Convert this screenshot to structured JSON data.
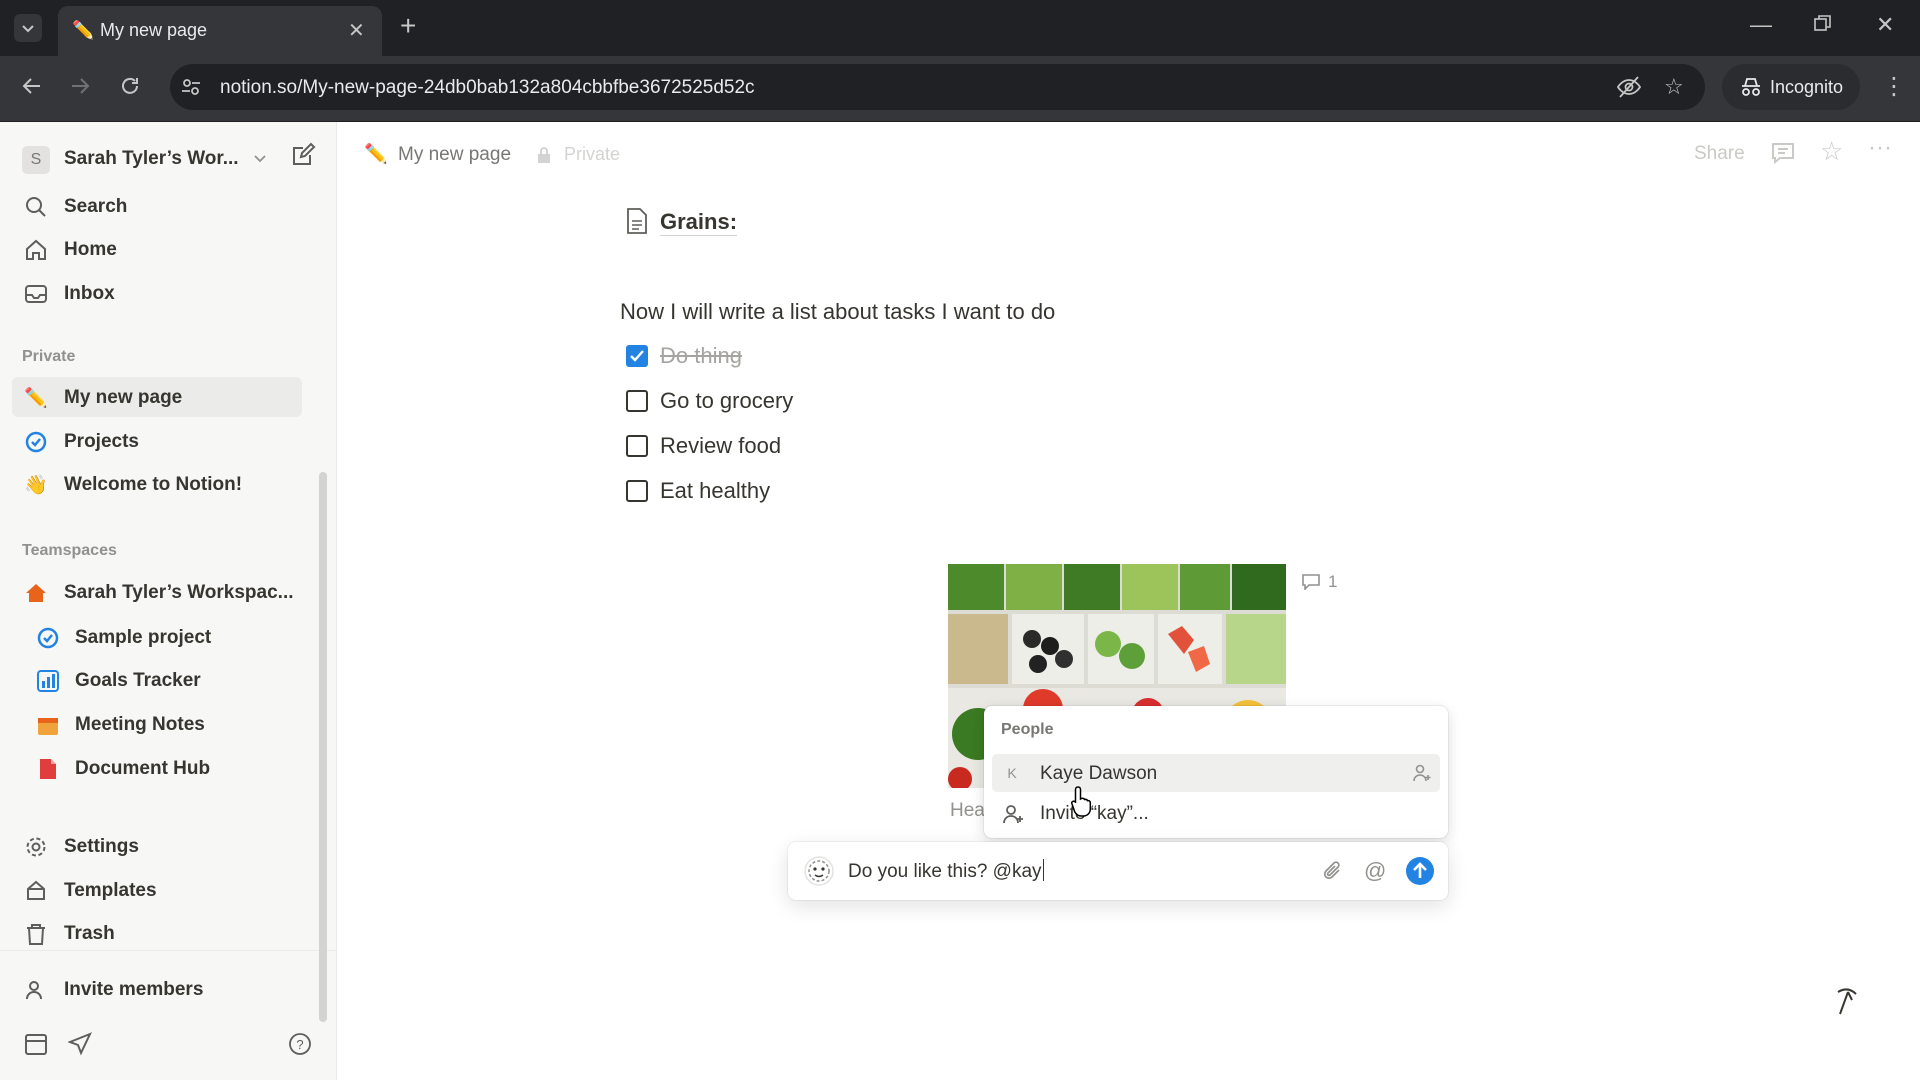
{
  "browser": {
    "tab_title": "My new page",
    "url": "notion.so/My-new-page-24db0bab132a804cbbfbe3672525d52c",
    "incognito_label": "Incognito"
  },
  "sidebar": {
    "workspace_badge": "S",
    "workspace_name": "Sarah Tyler’s Wor...",
    "top_items": [
      {
        "label": "Search",
        "icon": "search-icon"
      },
      {
        "label": "Home",
        "icon": "home-icon"
      },
      {
        "label": "Inbox",
        "icon": "inbox-icon"
      }
    ],
    "private_label": "Private",
    "private_items": [
      {
        "label": "My new page",
        "icon": "pencil-emoji-icon"
      },
      {
        "label": "Projects",
        "icon": "projects-icon"
      },
      {
        "label": "Welcome to Notion!",
        "icon": "wave-emoji-icon"
      }
    ],
    "teamspaces_label": "Teamspaces",
    "teamspace_items": [
      {
        "label": "Sarah Tyler’s Workspac...",
        "icon": "home-emoji-icon"
      },
      {
        "label": "Sample project",
        "icon": "projects-icon"
      },
      {
        "label": "Goals Tracker",
        "icon": "goals-icon"
      },
      {
        "label": "Meeting Notes",
        "icon": "calendar-icon"
      },
      {
        "label": "Document Hub",
        "icon": "document-icon"
      }
    ],
    "bottom_items": [
      {
        "label": "Settings",
        "icon": "gear-icon"
      },
      {
        "label": "Templates",
        "icon": "templates-icon"
      },
      {
        "label": "Trash",
        "icon": "trash-icon"
      }
    ],
    "invite_label": "Invite members"
  },
  "topbar": {
    "page_title": "My new page",
    "privacy": "Private",
    "share_label": "Share"
  },
  "content": {
    "subpage_title": "Grains:",
    "intro": "Now I will write a list about tasks I want to do",
    "todos": [
      {
        "label": "Do thing",
        "checked": true
      },
      {
        "label": "Go to grocery",
        "checked": false
      },
      {
        "label": "Review food",
        "checked": false
      },
      {
        "label": "Eat healthy",
        "checked": false
      }
    ],
    "image_comment_count": "1",
    "caption_partial": "Hea"
  },
  "mention_popup": {
    "header": "People",
    "person_initial": "K",
    "person_name": "Kaye Dawson",
    "invite_text": "Invite “kay”..."
  },
  "composer": {
    "text": "Do you like this? @kay"
  },
  "colors": {
    "accent": "#2383e2",
    "sidebar_bg": "#f7f7f5",
    "text": "#37352f"
  }
}
